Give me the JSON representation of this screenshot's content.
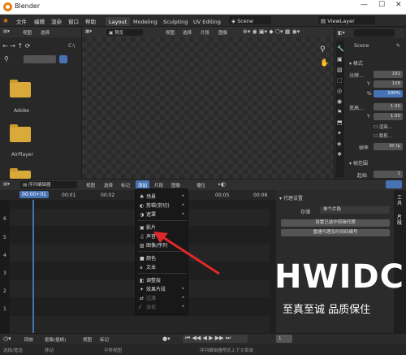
{
  "window": {
    "title": "Blender",
    "controls": [
      "—",
      "☐",
      "✕"
    ]
  },
  "menubar": {
    "items": [
      "文件",
      "编辑",
      "渲染",
      "窗口",
      "帮助"
    ],
    "workspaces": [
      "Layout",
      "Modeling",
      "Sculpting",
      "UV Editing"
    ],
    "scene": "Scene",
    "view_layer": "ViewLayer"
  },
  "file_browser": {
    "header": [
      "视图",
      "选择"
    ],
    "path": "C:\\",
    "folders": [
      "Adobe",
      "AirPlayer"
    ]
  },
  "preview": {
    "mode": "预览",
    "menus": [
      "视图",
      "选择",
      "片段",
      "图像"
    ]
  },
  "properties": {
    "scene_name": "Scene",
    "format_title": "格式",
    "resolution_label": "分辨...",
    "res_x": "192",
    "res_y": "108",
    "res_pct": "100%",
    "aspect_label": "宽高...",
    "aspect_x": "1.00",
    "aspect_y": "1.00",
    "render_region": "渲染...",
    "crop": "裁剪...",
    "frame_rate_label": "帧率",
    "frame_rate": "30 fp",
    "frame_range_title": "帧范围",
    "start_label": "起始",
    "start": "1"
  },
  "sequencer": {
    "editor_label": "序列编辑器",
    "menus": [
      "视图",
      "选择",
      "标记",
      "添加",
      "片段",
      "图像"
    ],
    "pivot": "播位",
    "current_time": "00:00+01",
    "ticks": [
      "00:01",
      "00:02",
      "00:03",
      "00:04",
      "00:05",
      "00:06"
    ],
    "channels": [
      "6",
      "5",
      "4",
      "3",
      "2",
      "1"
    ]
  },
  "add_menu": {
    "items": [
      {
        "label": "场景",
        "icon": "♣",
        "arrow": true
      },
      {
        "label": "剪辑(剪切)",
        "icon": "◐",
        "arrow": true
      },
      {
        "label": "遮罩",
        "icon": "◑",
        "arrow": true
      },
      {
        "label": "影片",
        "icon": "▣",
        "arrow": false
      },
      {
        "label": "声音",
        "icon": "♫",
        "arrow": false
      },
      {
        "label": "图像/序列",
        "icon": "▨",
        "arrow": false
      },
      {
        "label": "颜色",
        "icon": "■",
        "arrow": false
      },
      {
        "label": "文本",
        "icon": "a",
        "arrow": false
      },
      {
        "label": "调整层",
        "icon": "◧",
        "arrow": false
      },
      {
        "label": "效果片段",
        "icon": "✦",
        "arrow": true
      },
      {
        "label": "过渡",
        "icon": "⇄",
        "arrow": true
      },
      {
        "label": "淡化",
        "icon": "⁄",
        "arrow": true
      }
    ]
  },
  "proxy_panel": {
    "title": "代理设置",
    "storage_label": "存储",
    "storage_value": "单个片段",
    "set_btn": "设置已选中剪辑代理",
    "rebuild_btn": "重建代理及时间码编号",
    "side_tabs": [
      "工具",
      "片段"
    ]
  },
  "watermark": {
    "brand": "HWIDC",
    "tagline": "至真至诚 品质保住"
  },
  "timeline_bar": {
    "items": [
      "回放",
      "抠像(插帧)",
      "视图",
      "标记"
    ],
    "frame": "1"
  },
  "statusbar": {
    "items": [
      "选择/框选",
      "移动",
      "平移视图",
      "序列编辑器预览上下文菜单"
    ]
  },
  "colors": {
    "accent": "#4772b3",
    "playhead": "#4772b3",
    "arrow": "#e0282a"
  }
}
